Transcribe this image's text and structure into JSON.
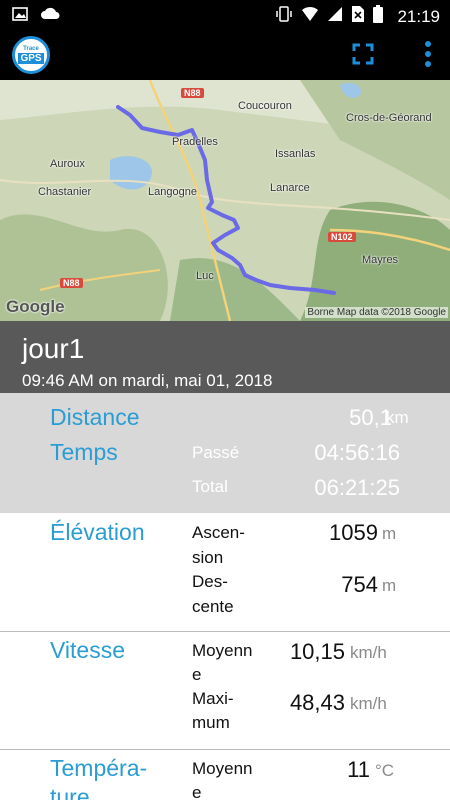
{
  "status_bar": {
    "time": "21:19"
  },
  "app": {
    "logo_top": "Trace",
    "logo_main": "GPS"
  },
  "map": {
    "places": [
      "Coucouron",
      "Cros-de-Géorand",
      "Pradelles",
      "Issanlas",
      "Auroux",
      "Chastanier",
      "Langogne",
      "Lanarce",
      "Mayres",
      "Luc"
    ],
    "roads": [
      "N88",
      "N102",
      "N88"
    ],
    "google_logo": "Google",
    "attribution": "Borne Map data ©2018 Google"
  },
  "track": {
    "name": "jour1",
    "date": "09:46 AM on mardi, mai 01, 2018"
  },
  "stats": {
    "distance": {
      "label": "Distance",
      "value": "50,1",
      "unit": "km"
    },
    "temps": {
      "label": "Temps",
      "passe_label": "Passé",
      "passe_value": "04:56:16",
      "total_label": "Total",
      "total_value": "06:21:25"
    },
    "elevation": {
      "label": "Élévation",
      "ascension_label1": "Ascen-",
      "ascension_label2": "sion",
      "ascension_value": "1059",
      "ascension_unit": "m",
      "descente_label1": "Des-",
      "descente_label2": "cente",
      "descente_value": "754",
      "descente_unit": "m"
    },
    "vitesse": {
      "label": "Vitesse",
      "moyenne_label1": "Moyenn",
      "moyenne_label2": "e",
      "moyenne_value": "10,15",
      "moyenne_unit": "km/h",
      "maximum_label1": "Maxi-",
      "maximum_label2": "mum",
      "maximum_value": "48,43",
      "maximum_unit": "km/h"
    },
    "temperature": {
      "label1": "Tempéra-",
      "label2": "ture",
      "moyenne_label1": "Moyenn",
      "moyenne_label2": "e",
      "moyenne_value": "11",
      "moyenne_unit": "°C"
    }
  },
  "colors": {
    "accent": "#2a9dd4",
    "header_bg": "#595959",
    "stats_gray": "#d8d8d8",
    "route": "#6a6ae6"
  }
}
